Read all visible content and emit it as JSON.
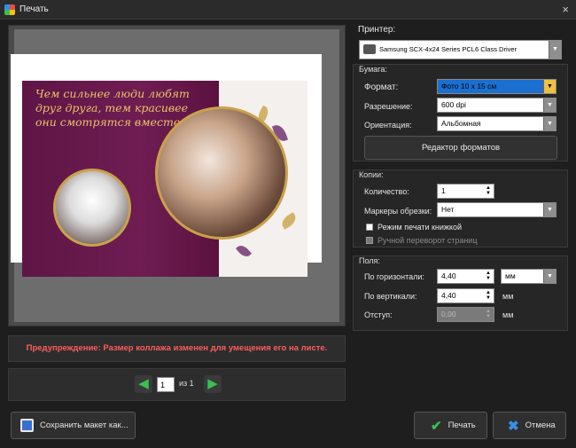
{
  "window": {
    "title": "Печать",
    "close": "×"
  },
  "preview": {
    "quote": "Чем сильнее люди любят друг друга, тем красивее они смотрятся вместе.",
    "warning": "Предупреждение: Размер коллажа изменен для умещения его на листе.",
    "page_current": "1",
    "page_of": "из 1"
  },
  "printer": {
    "label": "Принтер:",
    "selected": "Samsung SCX-4x24 Series PCL6 Class Driver"
  },
  "paper": {
    "group_label": "Бумага:",
    "format_label": "Формат:",
    "format_value": "Фото 10 x 15 см",
    "resolution_label": "Разрешение:",
    "resolution_value": "600 dpi",
    "orientation_label": "Ориентация:",
    "orientation_value": "Альбомная",
    "format_editor_button": "Редактор форматов"
  },
  "copies": {
    "group_label": "Копии:",
    "quantity_label": "Количество:",
    "quantity_value": "1",
    "crop_marks_label": "Маркеры обрезки:",
    "crop_marks_value": "Нет",
    "booklet_label": "Режим печати книжкой",
    "manual_duplex_label": "Ручной переворот страниц"
  },
  "margins": {
    "group_label": "Поля:",
    "horizontal_label": "По горизонтали:",
    "horizontal_value": "4,40",
    "unit_select": "мм",
    "vertical_label": "По вертикали:",
    "vertical_value": "4,40",
    "vertical_unit": "мм",
    "indent_label": "Отступ:",
    "indent_value": "0,00",
    "indent_unit": "мм"
  },
  "footer": {
    "save_layout": "Сохранить макет как...",
    "print": "Печать",
    "cancel": "Отмена"
  },
  "colors": {
    "warning": "#ff5d5d",
    "accent_gold": "#c9a24a",
    "print_check": "#3bbf52",
    "cancel_x": "#3a8fe6"
  }
}
